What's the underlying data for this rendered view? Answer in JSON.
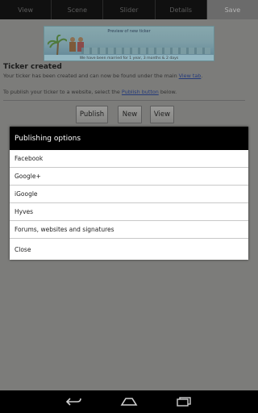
{
  "tabs": [
    {
      "label": "View",
      "active": false
    },
    {
      "label": "Scene",
      "active": false
    },
    {
      "label": "Slider",
      "active": false
    },
    {
      "label": "Details",
      "active": false
    },
    {
      "label": "Save",
      "active": true
    }
  ],
  "preview": {
    "title": "Preview of new ticker",
    "caption": "We have been married for 1 year, 3 months & 2 days"
  },
  "main": {
    "heading": "Ticker created",
    "line1_prefix": "Your ticker has been created and can now be found under the main ",
    "line1_link": "View tab",
    "line1_suffix": ".",
    "line2_prefix": "To publish your ticker to a website, select the ",
    "line2_link": "Publish button",
    "line2_suffix": " below."
  },
  "buttons": {
    "publish": "Publish",
    "new": "New",
    "view": "View"
  },
  "dialog": {
    "title": "Publishing options",
    "options": [
      "Facebook",
      "Google+",
      "iGoogle",
      "Hyves",
      "Forums, websites and signatures",
      "Close"
    ]
  },
  "navbar": {
    "icons": [
      "back-icon",
      "home-icon",
      "recent-apps-icon"
    ]
  }
}
